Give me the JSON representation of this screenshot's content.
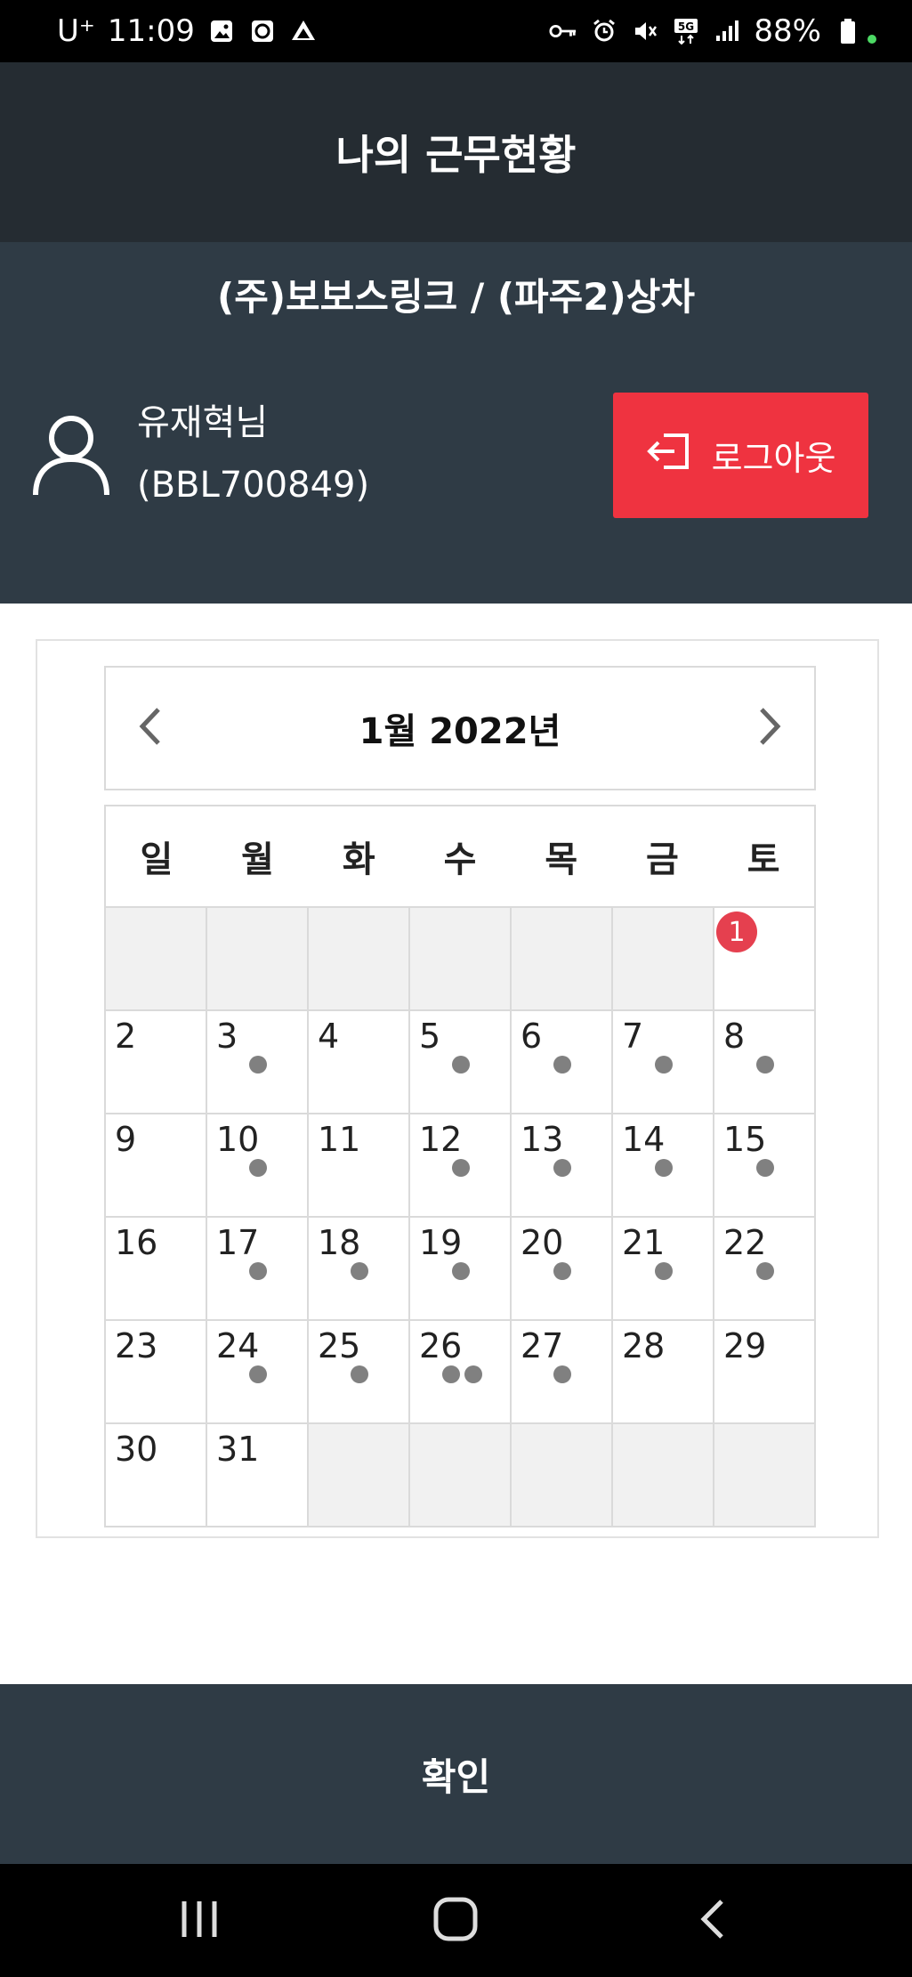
{
  "status_bar": {
    "carrier": "U⁺",
    "time": "11:09",
    "battery": "88%"
  },
  "header": {
    "title": "나의 근무현황"
  },
  "info": {
    "company": "(주)보보스링크 / (파주2)상차",
    "user_name": "유재혁님",
    "user_id": "(BBL700849)",
    "logout_label": "로그아웃"
  },
  "calendar": {
    "month_label": "1월 2022년",
    "weekdays": [
      "일",
      "월",
      "화",
      "수",
      "목",
      "금",
      "토"
    ],
    "badge_count": "1",
    "weeks": [
      [
        {
          "day": "",
          "dots": 0
        },
        {
          "day": "",
          "dots": 0
        },
        {
          "day": "",
          "dots": 0
        },
        {
          "day": "",
          "dots": 0
        },
        {
          "day": "",
          "dots": 0
        },
        {
          "day": "",
          "dots": 0
        },
        {
          "day": "",
          "dots": 0,
          "badge": true
        }
      ],
      [
        {
          "day": "2",
          "dots": 0
        },
        {
          "day": "3",
          "dots": 1
        },
        {
          "day": "4",
          "dots": 0
        },
        {
          "day": "5",
          "dots": 1
        },
        {
          "day": "6",
          "dots": 1
        },
        {
          "day": "7",
          "dots": 1
        },
        {
          "day": "8",
          "dots": 1
        }
      ],
      [
        {
          "day": "9",
          "dots": 0
        },
        {
          "day": "10",
          "dots": 1
        },
        {
          "day": "11",
          "dots": 0
        },
        {
          "day": "12",
          "dots": 1
        },
        {
          "day": "13",
          "dots": 1
        },
        {
          "day": "14",
          "dots": 1
        },
        {
          "day": "15",
          "dots": 1
        }
      ],
      [
        {
          "day": "16",
          "dots": 0
        },
        {
          "day": "17",
          "dots": 1
        },
        {
          "day": "18",
          "dots": 1
        },
        {
          "day": "19",
          "dots": 1
        },
        {
          "day": "20",
          "dots": 1
        },
        {
          "day": "21",
          "dots": 1
        },
        {
          "day": "22",
          "dots": 1
        }
      ],
      [
        {
          "day": "23",
          "dots": 0
        },
        {
          "day": "24",
          "dots": 1
        },
        {
          "day": "25",
          "dots": 1
        },
        {
          "day": "26",
          "dots": 2
        },
        {
          "day": "27",
          "dots": 1
        },
        {
          "day": "28",
          "dots": 0
        },
        {
          "day": "29",
          "dots": 0
        }
      ],
      [
        {
          "day": "30",
          "dots": 0
        },
        {
          "day": "31",
          "dots": 0
        },
        {
          "day": "",
          "dots": 0
        },
        {
          "day": "",
          "dots": 0
        },
        {
          "day": "",
          "dots": 0
        },
        {
          "day": "",
          "dots": 0
        },
        {
          "day": "",
          "dots": 0
        }
      ]
    ]
  },
  "footer": {
    "confirm_label": "확인"
  },
  "colors": {
    "header_bg": "#252c32",
    "info_bg": "#2f3b45",
    "logout_bg": "#ef3340",
    "badge_bg": "#e5404f",
    "dot": "#808080",
    "empty_cell": "#f1f1f1"
  },
  "icons": {
    "status_left": [
      "gallery-icon",
      "clock-app-icon",
      "navigation-icon"
    ],
    "status_right": [
      "key-icon",
      "alarm-icon",
      "mute-icon",
      "5g-icon",
      "signal-icon",
      "battery-icon"
    ],
    "nav": [
      "recent-apps-icon",
      "home-icon",
      "back-icon"
    ]
  }
}
